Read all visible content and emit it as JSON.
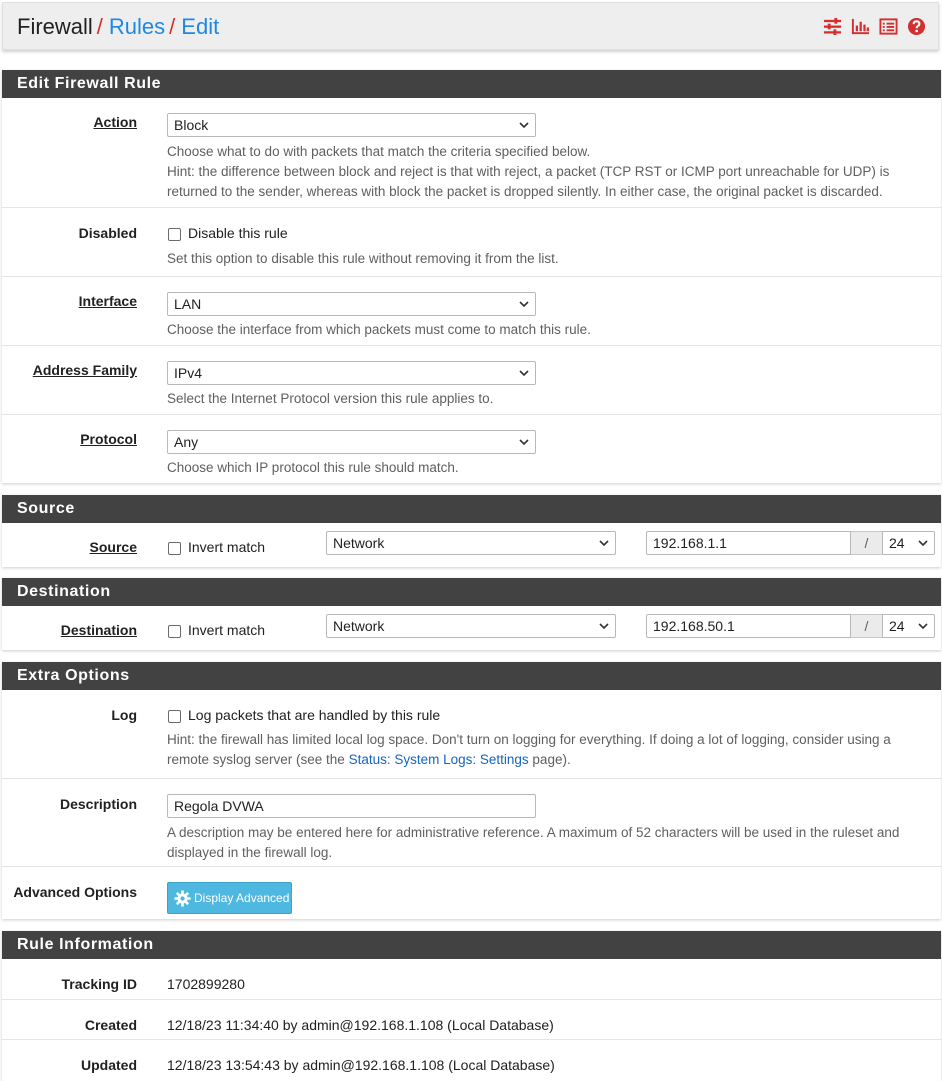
{
  "breadcrumb": {
    "first": "Firewall",
    "sep": "/",
    "rules": "Rules",
    "edit": "Edit"
  },
  "toolbar_icons": [
    "sliders-icon",
    "bar-chart-icon",
    "list-icon",
    "help-icon"
  ],
  "accent_colors": {
    "header_bg": "#424242",
    "link": "#1e88e5",
    "icon_red": "#d32f2f",
    "button_info": "#4fb8e0"
  },
  "edit_panel": {
    "title": "Edit Firewall Rule",
    "action": {
      "label": "Action",
      "value": "Block",
      "help1": "Choose what to do with packets that match the criteria specified below.",
      "help2": "Hint: the difference between block and reject is that with reject, a packet (TCP RST or ICMP port unreachable for UDP) is returned to the sender, whereas with block the packet is dropped silently. In either case, the original packet is discarded."
    },
    "disabled": {
      "label": "Disabled",
      "checkbox_label": "Disable this rule",
      "checked": false,
      "help": "Set this option to disable this rule without removing it from the list."
    },
    "interface": {
      "label": "Interface",
      "value": "LAN",
      "help": "Choose the interface from which packets must come to match this rule."
    },
    "address_family": {
      "label": "Address Family",
      "value": "IPv4",
      "help": "Select the Internet Protocol version this rule applies to."
    },
    "protocol": {
      "label": "Protocol",
      "value": "Any",
      "help": "Choose which IP protocol this rule should match."
    }
  },
  "source_panel": {
    "title": "Source",
    "label": "Source",
    "invert_label": "Invert match",
    "invert_checked": false,
    "type": "Network",
    "address": "192.168.1.1",
    "slash": "/",
    "mask": "24"
  },
  "dest_panel": {
    "title": "Destination",
    "label": "Destination",
    "invert_label": "Invert match",
    "invert_checked": false,
    "type": "Network",
    "address": "192.168.50.1",
    "slash": "/",
    "mask": "24"
  },
  "extra_panel": {
    "title": "Extra Options",
    "log": {
      "label": "Log",
      "checkbox_label": "Log packets that are handled by this rule",
      "checked": false,
      "help_pre": "Hint: the firewall has limited local log space. Don't turn on logging for everything. If doing a lot of logging, consider using a remote syslog server (see the ",
      "help_link": "Status: System Logs: Settings",
      "help_post": " page)."
    },
    "description": {
      "label": "Description",
      "value": "Regola DVWA",
      "help": "A description may be entered here for administrative reference. A maximum of 52 characters will be used in the ruleset and displayed in the firewall log."
    },
    "advanced": {
      "label": "Advanced Options",
      "button_label": "Display Advanced"
    }
  },
  "info_panel": {
    "title": "Rule Information",
    "tracking": {
      "label": "Tracking ID",
      "value": "1702899280"
    },
    "created": {
      "label": "Created",
      "value": "12/18/23 11:34:40 by admin@192.168.1.108 (Local Database)"
    },
    "updated": {
      "label": "Updated",
      "value": "12/18/23 13:54:43 by admin@192.168.1.108 (Local Database)"
    }
  }
}
